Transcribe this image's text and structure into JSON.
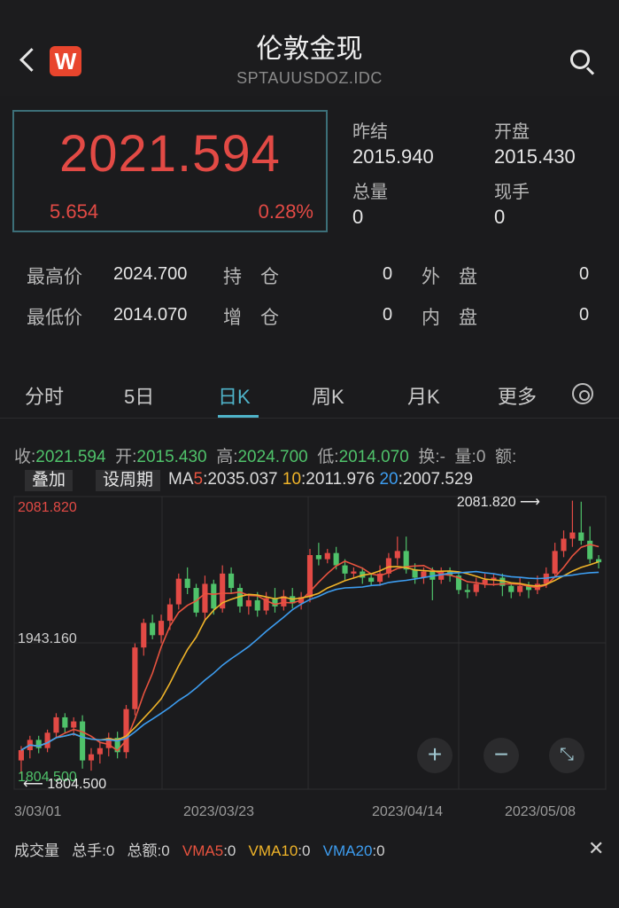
{
  "header": {
    "title": "伦敦金现",
    "subtitle": "SPTAUUSDOZ.IDC",
    "logo": "W"
  },
  "quote": {
    "price": "2021.594",
    "change": "5.654",
    "change_pct": "0.28%",
    "prev_close_label": "昨结",
    "prev_close": "2015.940",
    "open_label": "开盘",
    "open": "2015.430",
    "volume_label": "总量",
    "volume": "0",
    "hand_label": "现手",
    "hand": "0"
  },
  "stats": {
    "high_label": "最高价",
    "high": "2024.700",
    "low_label": "最低价",
    "low": "2014.070",
    "hold_label": "持　仓",
    "hold": "0",
    "add_label": "增　仓",
    "add": "0",
    "outer_label": "外　盘",
    "outer": "0",
    "inner_label": "内　盘",
    "inner": "0"
  },
  "tabs": [
    "分时",
    "5日",
    "日K",
    "周K",
    "月K",
    "更多"
  ],
  "active_tab": "日K",
  "info": {
    "close_k": "收:",
    "close_v": "2021.594",
    "open_k": "开:",
    "open_v": "2015.430",
    "high_k": "高:",
    "high_v": "2024.700",
    "low_k": "低:",
    "low_v": "2014.070",
    "turn_k": "换:",
    "turn_v": "-",
    "vol_k": "量:",
    "vol_v": "0",
    "amt_k": "额:"
  },
  "controls": {
    "overlay": "叠加",
    "period": "设周期"
  },
  "ma": {
    "label": "MA",
    "ma5_k": "5",
    "ma5": ":2035.037",
    "ma10_k": "10",
    "ma10": ":2011.976",
    "ma20_k": "20",
    "ma20": ":2007.529"
  },
  "volume_bar": {
    "label": "成交量",
    "total_hand": "总手:0",
    "total_amt": "总额:0",
    "vma5_k": "VMA5",
    "vma5": ":0",
    "vma10_k": "VMA10",
    "vma10": ":0",
    "vma20_k": "VMA20",
    "vma20": ":0"
  },
  "colors": {
    "up": "#e24a45",
    "down": "#4fc26a",
    "ma5": "#e8533f",
    "ma10": "#f0b429",
    "ma20": "#3d9df0",
    "accent": "#4fb3c9"
  },
  "chart_data": {
    "type": "candlestick",
    "y_top_label": "2081.820",
    "y_mid_label": "1943.160",
    "y_low_label": "1804.500",
    "max_marker": "2081.820",
    "min_marker": "1804.500",
    "ylim": [
      1800,
      2085
    ],
    "x_labels": [
      "3/03/01",
      "2023/03/23",
      "2023/04/14",
      "2023/05/08"
    ],
    "candles": [
      [
        1828,
        1838,
        1815,
        1842
      ],
      [
        1838,
        1848,
        1830,
        1852
      ],
      [
        1848,
        1840,
        1835,
        1852
      ],
      [
        1840,
        1855,
        1836,
        1858
      ],
      [
        1855,
        1870,
        1850,
        1874
      ],
      [
        1870,
        1860,
        1855,
        1874
      ],
      [
        1860,
        1866,
        1852,
        1870
      ],
      [
        1866,
        1828,
        1820,
        1872
      ],
      [
        1828,
        1834,
        1818,
        1840
      ],
      [
        1834,
        1840,
        1825,
        1845
      ],
      [
        1840,
        1850,
        1832,
        1855
      ],
      [
        1850,
        1836,
        1830,
        1856
      ],
      [
        1836,
        1878,
        1830,
        1882
      ],
      [
        1878,
        1938,
        1872,
        1942
      ],
      [
        1938,
        1962,
        1930,
        1966
      ],
      [
        1962,
        1950,
        1946,
        1970
      ],
      [
        1950,
        1964,
        1942,
        1970
      ],
      [
        1964,
        1980,
        1955,
        1986
      ],
      [
        1980,
        2005,
        1975,
        2010
      ],
      [
        2005,
        1996,
        1990,
        2016
      ],
      [
        1996,
        1972,
        1968,
        2000
      ],
      [
        1972,
        2000,
        1965,
        2008
      ],
      [
        2000,
        1976,
        1970,
        2004
      ],
      [
        1976,
        2010,
        1972,
        2018
      ],
      [
        2010,
        1996,
        1990,
        2016
      ],
      [
        1996,
        1978,
        1972,
        2000
      ],
      [
        1978,
        1984,
        1970,
        1990
      ],
      [
        1984,
        1974,
        1968,
        1992
      ],
      [
        1974,
        1986,
        1970,
        1992
      ],
      [
        1986,
        1978,
        1972,
        1996
      ],
      [
        1978,
        1988,
        1974,
        1994
      ],
      [
        1988,
        1981,
        1976,
        1996
      ],
      [
        1981,
        1987,
        1975,
        1992
      ],
      [
        1987,
        2028,
        1982,
        2034
      ],
      [
        2028,
        2024,
        2018,
        2040
      ],
      [
        2024,
        2030,
        2020,
        2034
      ],
      [
        2030,
        2018,
        2014,
        2036
      ],
      [
        2018,
        2010,
        2004,
        2024
      ],
      [
        2010,
        2012,
        2006,
        2016
      ],
      [
        2012,
        2006,
        2000,
        2016
      ],
      [
        2006,
        2002,
        1998,
        2010
      ],
      [
        2002,
        2010,
        1998,
        2018
      ],
      [
        2010,
        2025,
        2006,
        2030
      ],
      [
        2025,
        2032,
        2018,
        2046
      ],
      [
        2032,
        2014,
        2010,
        2046
      ],
      [
        2014,
        2006,
        2000,
        2020
      ],
      [
        2006,
        2012,
        2000,
        2016
      ],
      [
        2012,
        2004,
        1984,
        2016
      ],
      [
        2004,
        2012,
        2000,
        2016
      ],
      [
        2012,
        2008,
        2002,
        2016
      ],
      [
        2008,
        1994,
        1990,
        2012
      ],
      [
        1994,
        1992,
        1986,
        2000
      ],
      [
        1992,
        2000,
        1988,
        2006
      ],
      [
        2000,
        2004,
        1996,
        2010
      ],
      [
        2004,
        2006,
        1998,
        2010
      ],
      [
        2006,
        1998,
        1988,
        2010
      ],
      [
        1998,
        1992,
        1986,
        2000
      ],
      [
        1992,
        1998,
        1988,
        2006
      ],
      [
        1998,
        1994,
        1986,
        2002
      ],
      [
        1994,
        2000,
        1990,
        2008
      ],
      [
        2000,
        2010,
        1996,
        2016
      ],
      [
        2010,
        2032,
        2006,
        2040
      ],
      [
        2032,
        2044,
        2026,
        2052
      ],
      [
        2044,
        2050,
        2036,
        2081
      ],
      [
        2050,
        2042,
        2038,
        2080
      ],
      [
        2042,
        2024,
        2020,
        2056
      ],
      [
        2024,
        2021,
        2015,
        2028
      ]
    ]
  }
}
